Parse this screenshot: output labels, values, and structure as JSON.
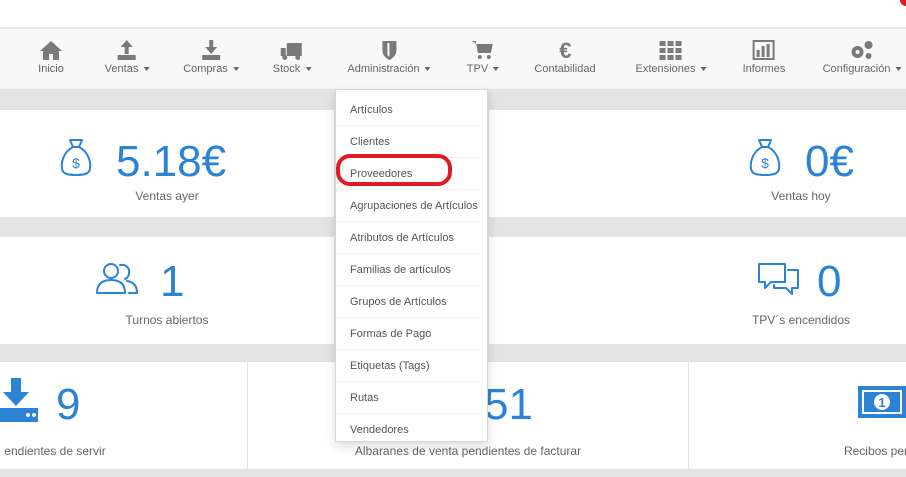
{
  "colors": {
    "accent": "#2b83d6",
    "highlight": "#e01b22",
    "navbar_bg": "#f8f8f8"
  },
  "nav": {
    "items": [
      {
        "label": "Inicio",
        "icon": "home-icon",
        "dropdown": false
      },
      {
        "label": "Ventas",
        "icon": "upload-icon",
        "dropdown": true
      },
      {
        "label": "Compras",
        "icon": "download-icon",
        "dropdown": true
      },
      {
        "label": "Stock",
        "icon": "truck-icon",
        "dropdown": true
      },
      {
        "label": "Administración",
        "icon": "shield-icon",
        "dropdown": true
      },
      {
        "label": "TPV",
        "icon": "cart-icon",
        "dropdown": true
      },
      {
        "label": "Contabilidad",
        "icon": "euro-icon",
        "dropdown": false
      },
      {
        "label": "Extensiones",
        "icon": "grid-icon",
        "dropdown": true
      },
      {
        "label": "Informes",
        "icon": "bar-chart-icon",
        "dropdown": false
      },
      {
        "label": "Configuración",
        "icon": "cogs-icon",
        "dropdown": true
      }
    ]
  },
  "dropdown": {
    "items": [
      "Artículos",
      "Clientes",
      "Proveedores",
      "Agrupaciones de Artículos",
      "Atributos de Artículos",
      "Familias de artículos",
      "Grupos de Artículos",
      "Formas de Pago",
      "Etiquetas (Tags)",
      "Rutas",
      "Vendedores"
    ],
    "highlighted": "Proveedores"
  },
  "stats": {
    "ventas_ayer": {
      "value": "5.18€",
      "label": "Ventas ayer",
      "icon": "money-bag-icon"
    },
    "ventas_hoy": {
      "value": "0€",
      "label": "Ventas hoy",
      "icon": "money-bag-icon"
    },
    "turnos": {
      "value": "1",
      "label": "Turnos abiertos",
      "icon": "users-icon"
    },
    "tpvs": {
      "value": "0",
      "label": "TPV´s encendidos",
      "icon": "chat-bubbles-icon"
    },
    "pendientes_servir": {
      "value": "9",
      "label": "endientes de servir",
      "icon": "download-tray-icon"
    },
    "albaranes": {
      "value": "51",
      "label": "Albaranes de venta pendientes de facturar",
      "icon": "arrow-file-icon"
    },
    "recibos": {
      "value": "",
      "label": "Recibos pendi",
      "icon": "banknote-icon"
    }
  }
}
